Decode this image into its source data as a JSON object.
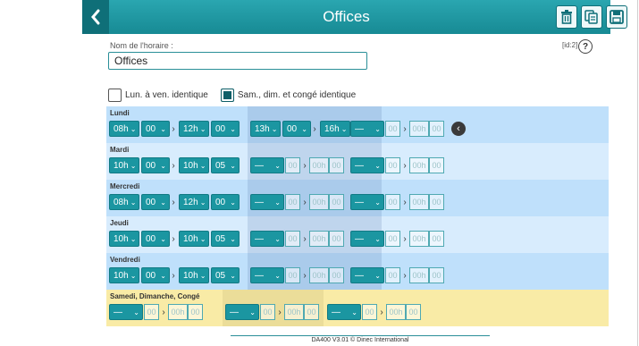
{
  "header": {
    "title": "Offices"
  },
  "form": {
    "name_label": "Nom de l'horaire :",
    "name_value": "Offices",
    "id_label": "[id:2]",
    "help_symbol": "?"
  },
  "options": {
    "weekdays_identical_label": "Lun. à ven. identique",
    "weekdays_identical_checked": false,
    "weekend_identical_label": "Sam., dim. et congé identique",
    "weekend_identical_checked": true
  },
  "placeholders": {
    "hour": "—",
    "minute_disabled": "00",
    "end_disabled": "00h",
    "minute_end_disabled": "00"
  },
  "days": [
    {
      "label": "Lundi",
      "ranges": [
        [
          "08h",
          "00",
          "12h",
          "00"
        ],
        [
          "13h",
          "00",
          "16h",
          "00"
        ]
      ]
    },
    {
      "label": "Mardi",
      "ranges": [
        [
          "10h",
          "00",
          "10h",
          "05"
        ]
      ]
    },
    {
      "label": "Mercredi",
      "ranges": [
        [
          "08h",
          "00",
          "12h",
          "00"
        ]
      ]
    },
    {
      "label": "Jeudi",
      "ranges": [
        [
          "10h",
          "00",
          "10h",
          "05"
        ]
      ]
    },
    {
      "label": "Vendredi",
      "ranges": [
        [
          "10h",
          "00",
          "10h",
          "05"
        ]
      ]
    },
    {
      "label": "Samedi, Dimanche, Congé",
      "ranges": []
    }
  ],
  "footer": {
    "text": "DA400 V3.01 © Dinec International"
  },
  "colors": {
    "accent": "#1b96a1",
    "header": "#178a94",
    "row_odd": "#bfe0fb",
    "row_even": "#d8ecfd",
    "weekend": "#f9eba6"
  }
}
